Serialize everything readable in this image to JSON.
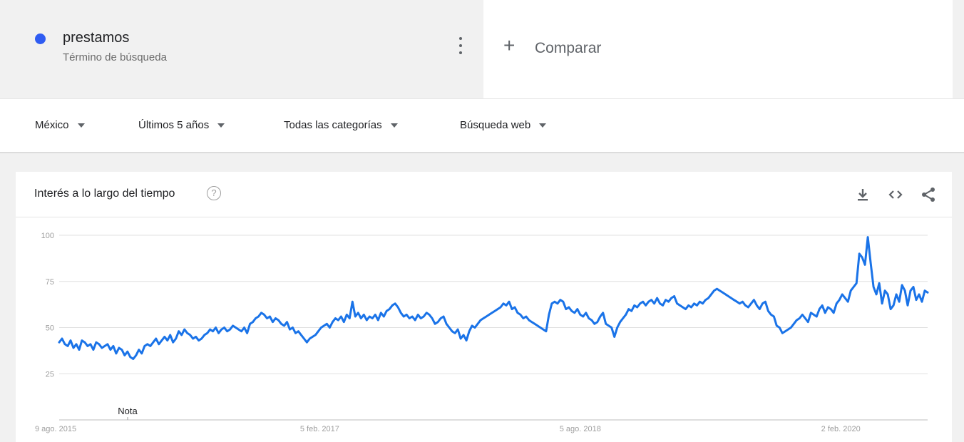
{
  "term": {
    "name": "prestamos",
    "subtitle": "Término de búsqueda",
    "color": "#2f5cf2"
  },
  "compare": {
    "label": "Comparar"
  },
  "filters": [
    {
      "label": "México"
    },
    {
      "label": "Últimos 5 años"
    },
    {
      "label": "Todas las categorías"
    },
    {
      "label": "Búsqueda web"
    }
  ],
  "card": {
    "title": "Interés a lo largo del tiempo",
    "icons": [
      "help-icon",
      "download-icon",
      "embed-icon",
      "share-icon"
    ]
  },
  "chart_data": {
    "type": "line",
    "title": "Interés a lo largo del tiempo",
    "xlabel": "",
    "ylabel": "",
    "ylim": [
      0,
      100
    ],
    "yticks": [
      25,
      50,
      75,
      100
    ],
    "x_start": "2015-08-09",
    "x_end": "2020-08-02",
    "x_tick_labels": [
      "9 ago. 2015",
      "5 feb. 2017",
      "5 ago. 2018",
      "2 feb. 2020"
    ],
    "annotation": "Nota",
    "line_color": "#1a73e8",
    "grid": true,
    "series": [
      {
        "values": [
          42,
          44,
          41,
          40,
          43,
          39,
          41,
          38,
          43,
          42,
          40,
          41,
          38,
          42,
          41,
          39,
          40,
          41,
          38,
          40,
          36,
          39,
          38,
          35,
          37,
          34,
          33,
          35,
          38,
          36,
          40,
          41,
          40,
          42,
          44,
          41,
          43,
          45,
          43,
          46,
          42,
          44,
          48,
          46,
          49,
          47,
          46,
          44,
          45,
          43,
          44,
          46,
          47,
          49,
          48,
          50,
          47,
          49,
          50,
          48,
          49,
          51,
          50,
          49,
          48,
          50,
          47,
          52,
          53,
          55,
          56,
          58,
          57,
          55,
          56,
          53,
          55,
          54,
          52,
          51,
          53,
          49,
          50,
          47,
          48,
          46,
          44,
          42,
          44,
          45,
          46,
          48,
          50,
          51,
          52,
          50,
          53,
          55,
          54,
          56,
          53,
          57,
          55,
          64,
          56,
          58,
          55,
          57,
          54,
          56,
          55,
          57,
          54,
          58,
          56,
          59,
          60,
          62,
          63,
          61,
          58,
          56,
          57,
          55,
          56,
          54,
          57,
          55,
          56,
          58,
          57,
          55,
          52,
          53,
          55,
          56,
          52,
          50,
          48,
          47,
          49,
          44,
          46,
          43,
          48,
          51,
          50,
          52,
          54,
          55,
          56,
          57,
          58,
          59,
          60,
          61,
          63,
          62,
          64,
          60,
          61,
          58,
          57,
          55,
          56,
          54,
          53,
          52,
          51,
          50,
          49,
          48,
          57,
          63,
          64,
          63,
          65,
          64,
          60,
          61,
          59,
          58,
          60,
          57,
          56,
          58,
          55,
          54,
          52,
          53,
          56,
          58,
          52,
          51,
          50,
          45,
          50,
          53,
          55,
          57,
          60,
          59,
          62,
          61,
          63,
          64,
          62,
          64,
          65,
          63,
          66,
          63,
          62,
          65,
          64,
          66,
          67,
          63,
          62,
          61,
          60,
          62,
          61,
          63,
          62,
          64,
          63,
          65,
          66,
          68,
          70,
          71,
          70,
          69,
          68,
          67,
          66,
          65,
          64,
          63,
          64,
          62,
          61,
          63,
          65,
          62,
          60,
          63,
          64,
          59,
          57,
          56,
          51,
          50,
          47,
          48,
          49,
          50,
          52,
          54,
          55,
          57,
          55,
          53,
          58,
          57,
          56,
          60,
          62,
          58,
          61,
          60,
          58,
          63,
          65,
          68,
          66,
          64,
          70,
          72,
          74,
          90,
          88,
          84,
          99,
          85,
          72,
          68,
          74,
          63,
          70,
          68,
          60,
          62,
          68,
          64,
          73,
          70,
          62,
          70,
          72,
          65,
          68,
          64,
          70,
          69
        ]
      }
    ]
  }
}
